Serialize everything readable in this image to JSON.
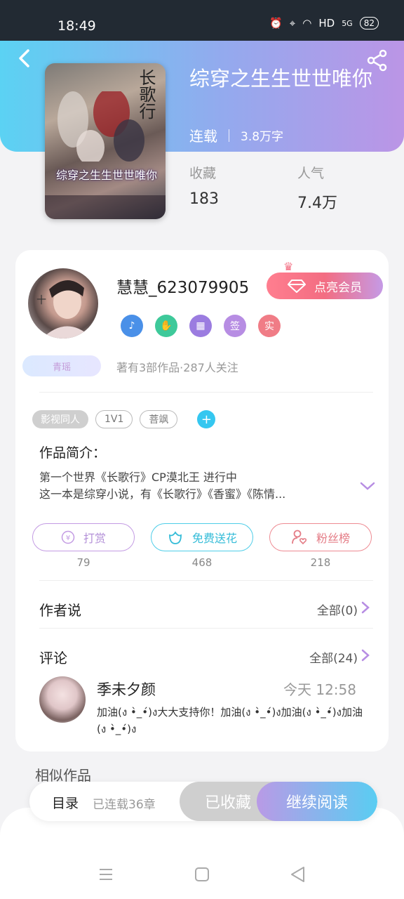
{
  "status": {
    "time": "18:49",
    "hd": "HD",
    "signal": "5G",
    "battery": "82"
  },
  "book": {
    "title": "综穿之生生世世唯你",
    "status": "连载",
    "words": "3.8万字",
    "cover_title": "综穿之生生世世唯你",
    "cover_vertical": "长歌行",
    "stats": [
      {
        "label": "收藏",
        "value": "183"
      },
      {
        "label": "人气",
        "value": "7.4万"
      }
    ]
  },
  "author": {
    "name": "慧慧_623079905",
    "vip_label": "点亮会员",
    "badges": [
      {
        "icon": "music-icon",
        "color": "#4a90e8",
        "text": "♪"
      },
      {
        "icon": "handshake-icon",
        "color": "#3ec99a",
        "text": "✋"
      },
      {
        "icon": "calendar-icon",
        "color": "#9b7ce0",
        "text": "▦"
      },
      {
        "icon": "sign-badge",
        "color": "#b78de3",
        "text": "签"
      },
      {
        "icon": "real-badge",
        "color": "#f07c86",
        "text": "实"
      }
    ],
    "level_tag": "青瑶",
    "works_line": "著有3部作品·287人关注"
  },
  "tags": [
    "影视同人",
    "1V1",
    "菩飒"
  ],
  "intro": {
    "title": "作品简介：",
    "line1": "第一个世界《长歌行》CP漠北王  进行中",
    "line2": "这一本是综穿小说，有《长歌行》《香蜜》《陈情..."
  },
  "actions": [
    {
      "label": "打赏",
      "count": "79"
    },
    {
      "label": "免费送花",
      "count": "468"
    },
    {
      "label": "粉丝榜",
      "count": "218"
    }
  ],
  "author_says": {
    "title": "作者说",
    "all": "全部(0)"
  },
  "comments": {
    "title": "评论",
    "all": "全部(24)",
    "first": {
      "name": "季未夕颜",
      "time": "今天 12:58",
      "text": "加油(ง •̀_•́)ง大大支持你！加油(ง •̀_•́)ง加油(ง •̀_•́)ง加油(ง •̀_•́)ง"
    }
  },
  "similar_title": "相似作品",
  "bottom_bar": {
    "toc": "目录",
    "chapters": "已连载36章",
    "saved": "已收藏",
    "read": "继续阅读"
  }
}
